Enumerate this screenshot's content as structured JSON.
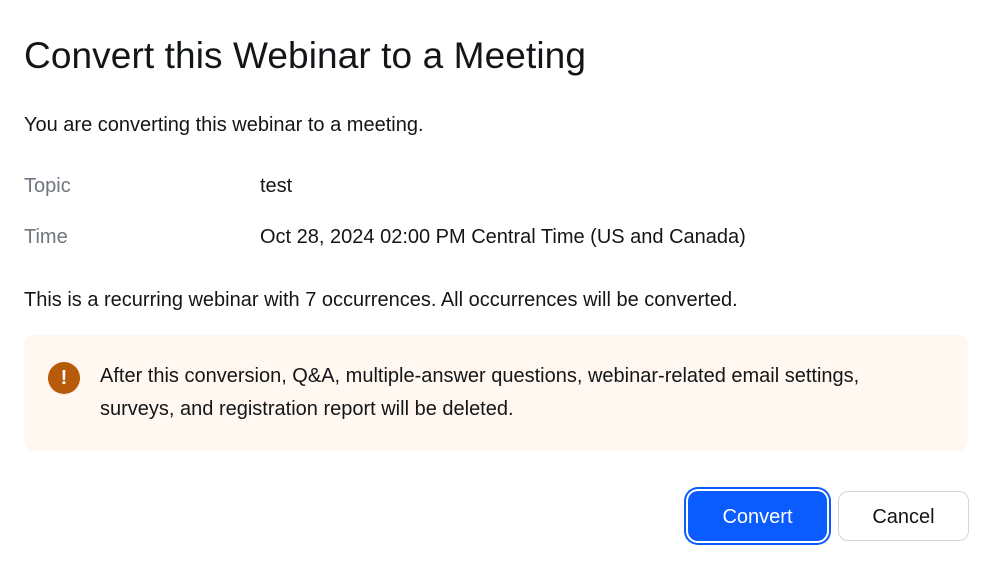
{
  "dialog": {
    "title": "Convert this Webinar to a Meeting",
    "intro": "You are converting this webinar to a meeting.",
    "details": [
      {
        "label": "Topic",
        "value": "test"
      },
      {
        "label": "Time",
        "value": "Oct 28, 2024 02:00 PM Central Time (US and Canada)"
      }
    ],
    "recurring_note": "This is a recurring webinar with 7 occurrences. All occurrences will be converted.",
    "warning": {
      "icon": "exclamation-icon",
      "icon_glyph": "!",
      "text": "After this conversion, Q&A, multiple-answer questions, webinar-related email settings, surveys, and registration report will be deleted.",
      "background_color": "#fff7f0",
      "icon_color": "#b75a0a"
    },
    "buttons": {
      "convert_label": "Convert",
      "cancel_label": "Cancel"
    },
    "colors": {
      "primary": "#0b5cff",
      "text": "#131619",
      "label": "#6e7680"
    }
  }
}
